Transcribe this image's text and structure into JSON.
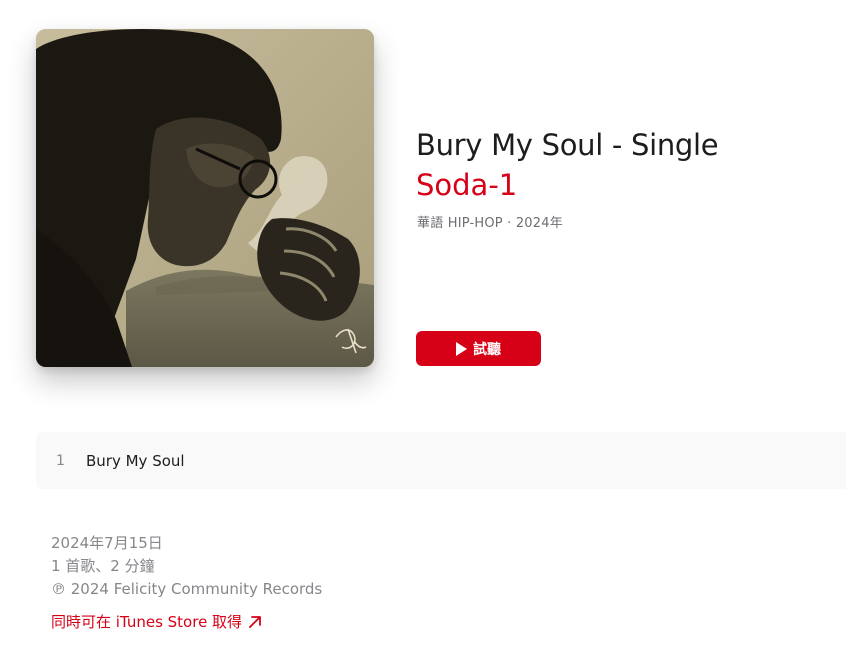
{
  "album": {
    "title": "Bury My Soul - Single",
    "artist": "Soda-1",
    "meta": "華語 HIP-HOP · 2024年",
    "artwork_icon": "album-artwork-portrait",
    "artwork_signature": "signature"
  },
  "actions": {
    "preview_label": "試聽",
    "preview_icon": "play-icon"
  },
  "tracks": [
    {
      "number": "1",
      "title": "Bury My Soul"
    }
  ],
  "footer": {
    "release_date": "2024年7月15日",
    "summary": "1 首歌、2 分鐘",
    "copyright": "℗ 2024 Felicity Community Records",
    "itunes_link": "同時可在 iTunes Store 取得",
    "itunes_link_icon": "arrow-up-right-icon"
  },
  "colors": {
    "accent": "#d60017",
    "title": "#1d1d1f",
    "secondary": "#6e6e73",
    "muted": "#86868b",
    "row_background": "#f9f9f9"
  }
}
